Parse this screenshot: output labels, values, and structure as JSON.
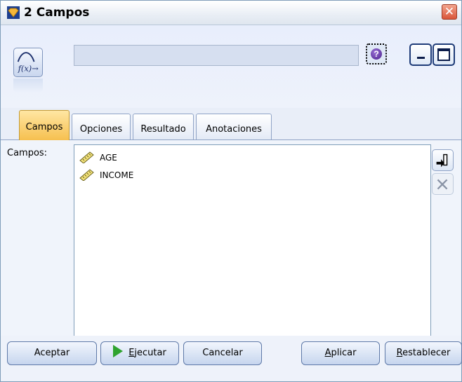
{
  "window": {
    "title": "2 Campos"
  },
  "header": {
    "node_icon": "function-fx-icon",
    "name_value": ""
  },
  "tabs": [
    {
      "label": "Campos",
      "active": true
    },
    {
      "label": "Opciones",
      "active": false
    },
    {
      "label": "Resultado",
      "active": false
    },
    {
      "label": "Anotaciones",
      "active": false
    }
  ],
  "fields": {
    "label": "Campos:",
    "items": [
      {
        "name": "AGE",
        "icon": "ruler-continuous-icon"
      },
      {
        "name": "INCOME",
        "icon": "ruler-continuous-icon"
      }
    ]
  },
  "footer": {
    "ok": "Aceptar",
    "run_prefix": "E",
    "run_rest": "jecutar",
    "cancel": "Cancelar",
    "apply_prefix": "A",
    "apply_rest": "plicar",
    "reset_prefix": "R",
    "reset_rest": "establecer"
  },
  "colors": {
    "active_tab": "#f6c04f",
    "close": "#d9553a",
    "run_play": "#2fa32f"
  }
}
